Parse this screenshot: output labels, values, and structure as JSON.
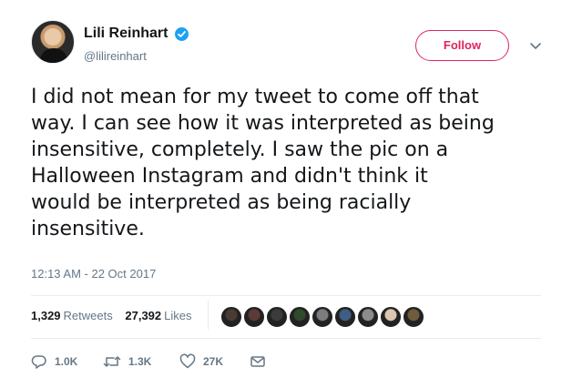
{
  "user": {
    "name": "Lili Reinhart",
    "handle": "@lilireinhart",
    "verified": true
  },
  "follow_label": "Follow",
  "tweet": {
    "text": "I did not mean for my tweet to come off that\nway. I can see how it was interpreted as being\ninsensitive, completely. I saw the pic on a\nHalloween Instagram and didn't think it\nwould be interpreted as being racially\ninsensitive.",
    "timestamp": "12:13 AM - 22 Oct 2017"
  },
  "stats": {
    "retweets_count": "1,329",
    "retweets_label": "Retweets",
    "likes_count": "27,392",
    "likes_label": "Likes"
  },
  "liker_avatars": [
    "#4a3b34",
    "#5c3a36",
    "#3c3c3c",
    "#2f4a2b",
    "#7d7d80",
    "#3f5e86",
    "#8c8c8c",
    "#d9c7b0",
    "#6e5c3a"
  ],
  "actions": {
    "reply_count": "1.0K",
    "retweet_count": "1.3K",
    "like_count": "27K"
  },
  "colors": {
    "accent": "#1da1f2",
    "follow": "#e0245e",
    "muted": "#657786"
  }
}
